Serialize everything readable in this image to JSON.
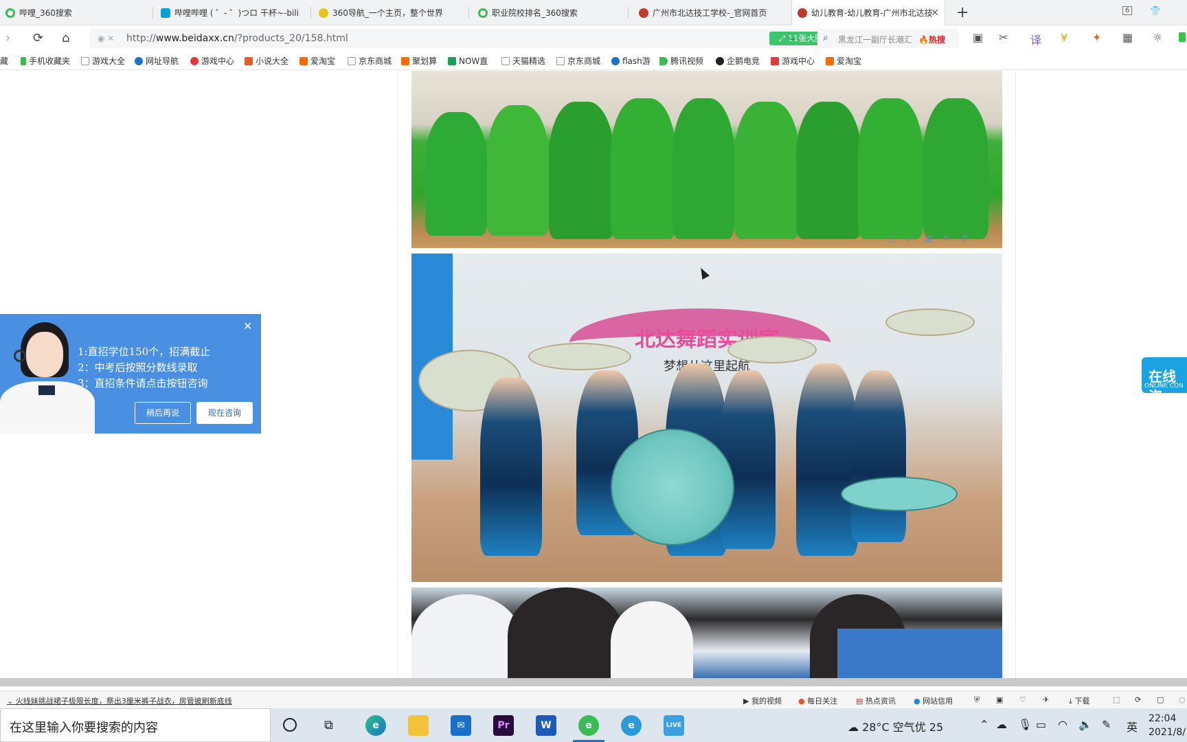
{
  "tabs": [
    {
      "label": "哔哩_360搜索",
      "active": false
    },
    {
      "label": "哔哩哔哩 ( ゜- ゜)つロ 干杯~-bili",
      "active": false
    },
    {
      "label": "360导航_一个主页，整个世界",
      "active": false
    },
    {
      "label": "职业院校排名_360搜索",
      "active": false
    },
    {
      "label": "广州市北达技工学校-_官网首页",
      "active": false
    },
    {
      "label": "幼儿教育-幼儿教育-广州市北达技",
      "active": true
    }
  ],
  "tab_count": "6",
  "address": {
    "url_prefix": "http://",
    "url_domain": "www.beidaxx.cn",
    "url_path": "/?products_20/158.html",
    "big_image_label": "11张大图"
  },
  "search": {
    "text": "黑龙江一副厅长潮汇",
    "hot_label": "热搜"
  },
  "bookmarks": [
    "藏",
    "手机收藏夹",
    "游戏大全",
    "网址导航",
    "游戏中心",
    "小说大全",
    "爱淘宝",
    "京东商城",
    "聚划算",
    "NOW直",
    "天猫精选",
    "京东商城",
    "flash游",
    "腾讯视频",
    "企鹅电竞",
    "游戏中心",
    "爱淘宝"
  ],
  "popup": {
    "line1": "1:直招学位150个，招满截止",
    "line2": "2：中考后按照分数线录取",
    "line3": "3：直招条件请点击按钮咨询",
    "later_button": "稍后再说",
    "consult_button": "现在咨询"
  },
  "photo2": {
    "sign_text": "北达舞蹈实训室",
    "slogan_text": "梦想从这里起航"
  },
  "online_consult": {
    "main": "在线咨",
    "sub": "ONLINE CON"
  },
  "statusbar": {
    "news": "火线妹挑战裙子极限长度，祭出3厘米裤子战衣，房管披刷新底线",
    "items": [
      "我的视频",
      "每日关注",
      "热点资讯",
      "网站信用",
      "下载"
    ]
  },
  "taskbar": {
    "search_placeholder": "在这里输入你要搜索的内容",
    "weather": "28°C 空气优 25",
    "ime": "英",
    "time": "22:04",
    "date": "2021/8/"
  }
}
